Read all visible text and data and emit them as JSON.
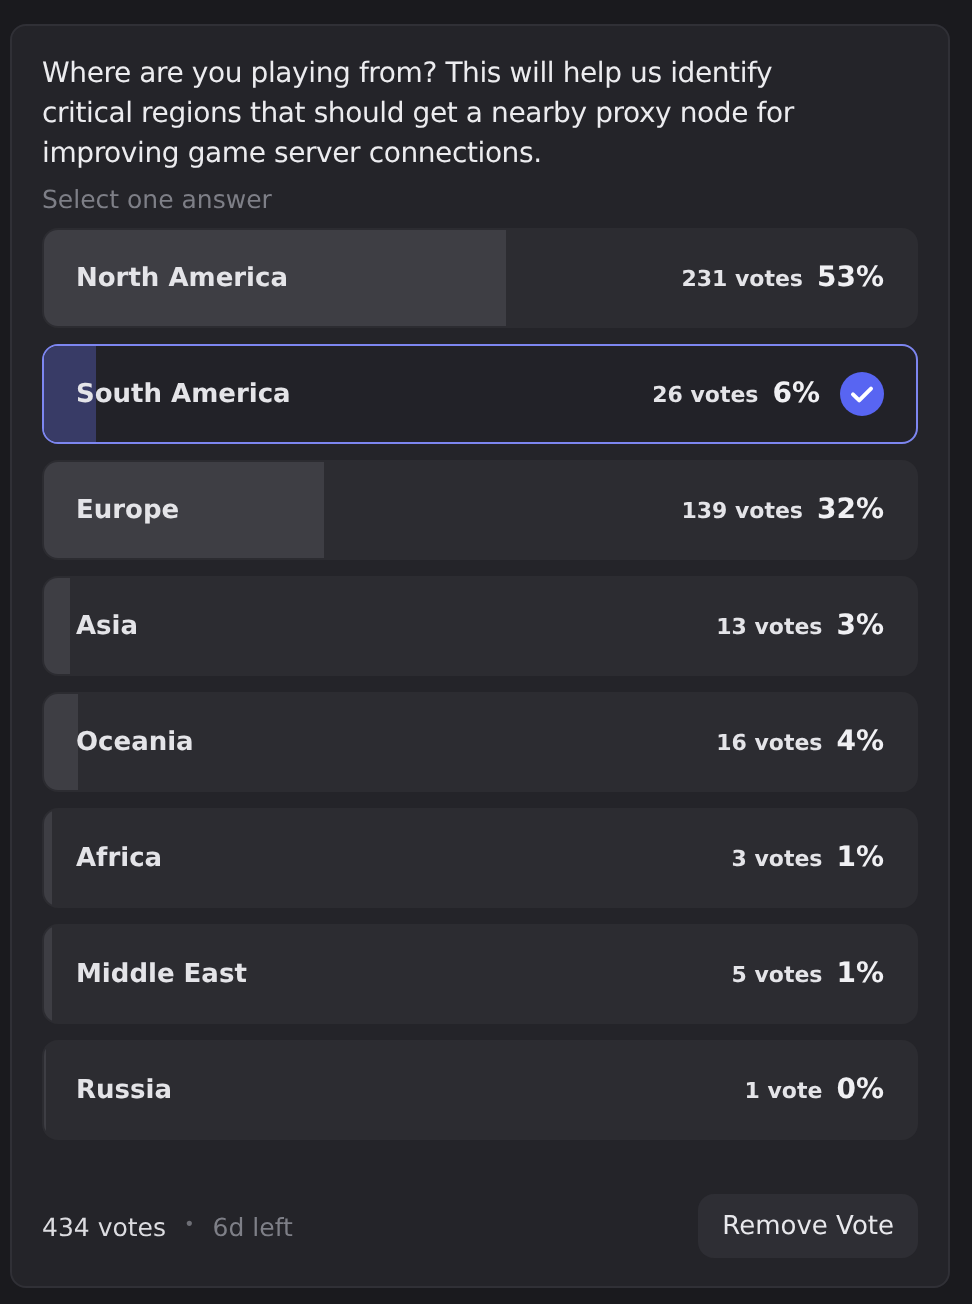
{
  "poll": {
    "question": "Where are you playing from? This will help us identify critical regions that should get a nearby proxy node for improving game server connections.",
    "hint": "Select one answer",
    "answers": [
      {
        "label": "North America",
        "votes": "231 votes",
        "percent": "53%",
        "level": 0.53,
        "selected": false
      },
      {
        "label": "South America",
        "votes": "26 votes",
        "percent": "6%",
        "level": 0.06,
        "selected": true
      },
      {
        "label": "Europe",
        "votes": "139 votes",
        "percent": "32%",
        "level": 0.32,
        "selected": false
      },
      {
        "label": "Asia",
        "votes": "13 votes",
        "percent": "3%",
        "level": 0.03,
        "selected": false
      },
      {
        "label": "Oceania",
        "votes": "16 votes",
        "percent": "4%",
        "level": 0.04,
        "selected": false
      },
      {
        "label": "Africa",
        "votes": "3 votes",
        "percent": "1%",
        "level": 0.01,
        "selected": false
      },
      {
        "label": "Middle East",
        "votes": "5 votes",
        "percent": "1%",
        "level": 0.01,
        "selected": false
      },
      {
        "label": "Russia",
        "votes": "1 vote",
        "percent": "0%",
        "level": 0.0,
        "selected": false
      }
    ],
    "total": "434 votes",
    "separator": "•",
    "time_left": "6d left",
    "button": "Remove Vote"
  }
}
